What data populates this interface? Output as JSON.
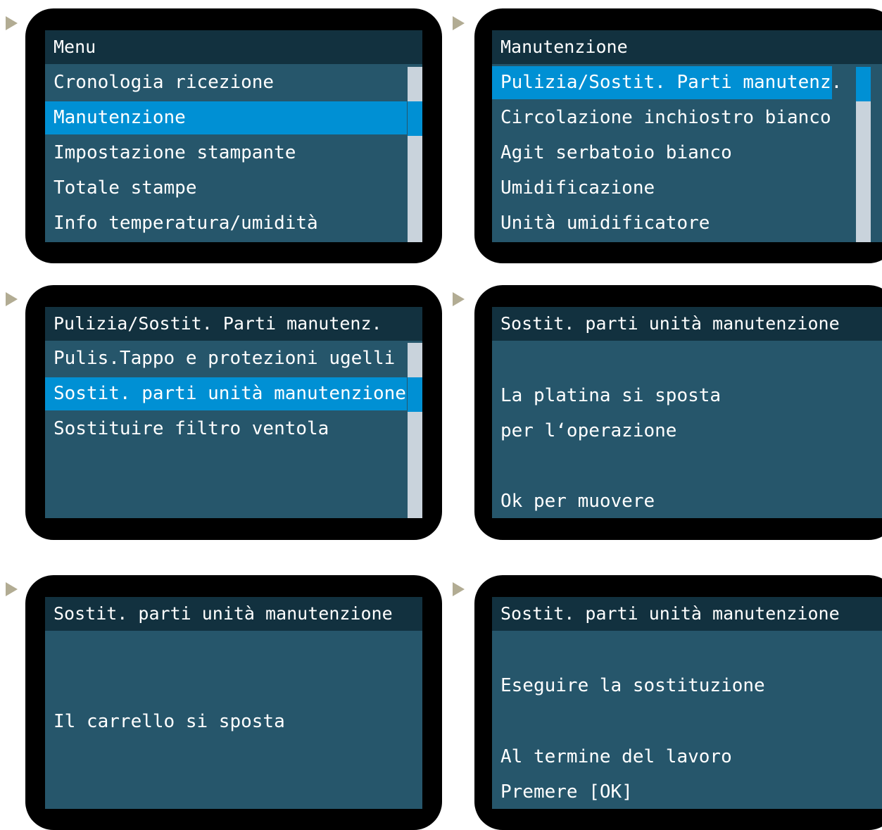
{
  "colors": {
    "screen_bg": "#26566b",
    "title_bg": "#12313f",
    "selection": "#0090d4",
    "scrollbar_track": "#c9d3dc",
    "bezel": "#000000",
    "arrow": "#b2ac93"
  },
  "panels": [
    {
      "title": "Menu",
      "items": [
        "Cronologia ricezione",
        "Manutenzione",
        "Impostazione stampante",
        "Totale stampe",
        "Info temperatura/umidità"
      ],
      "selected_index": 1
    },
    {
      "title": "Manutenzione",
      "items": [
        "Pulizia/Sostit. Parti manutenz.",
        "Circolazione inchiostro bianco",
        "Agit serbatoio bianco",
        "Umidificazione",
        "Unità umidificatore"
      ],
      "selected_index": 0
    },
    {
      "title": "Pulizia/Sostit. Parti manutenz.",
      "items": [
        "Pulis.Tappo e protezioni ugelli",
        "Sostit. parti unità manutenzione",
        "Sostituire filtro ventola"
      ],
      "selected_index": 1
    },
    {
      "title": "Sostit. parti unità manutenzione",
      "messages": [
        "La platina si sposta",
        "per l‘operazione",
        "Ok per muovere"
      ]
    },
    {
      "title": "Sostit. parti unità manutenzione",
      "messages": [
        "Il carrello si sposta"
      ]
    },
    {
      "title": "Sostit. parti unità manutenzione",
      "messages": [
        "Eseguire la sostituzione",
        "Al termine del lavoro",
        "Premere [OK]"
      ]
    }
  ]
}
